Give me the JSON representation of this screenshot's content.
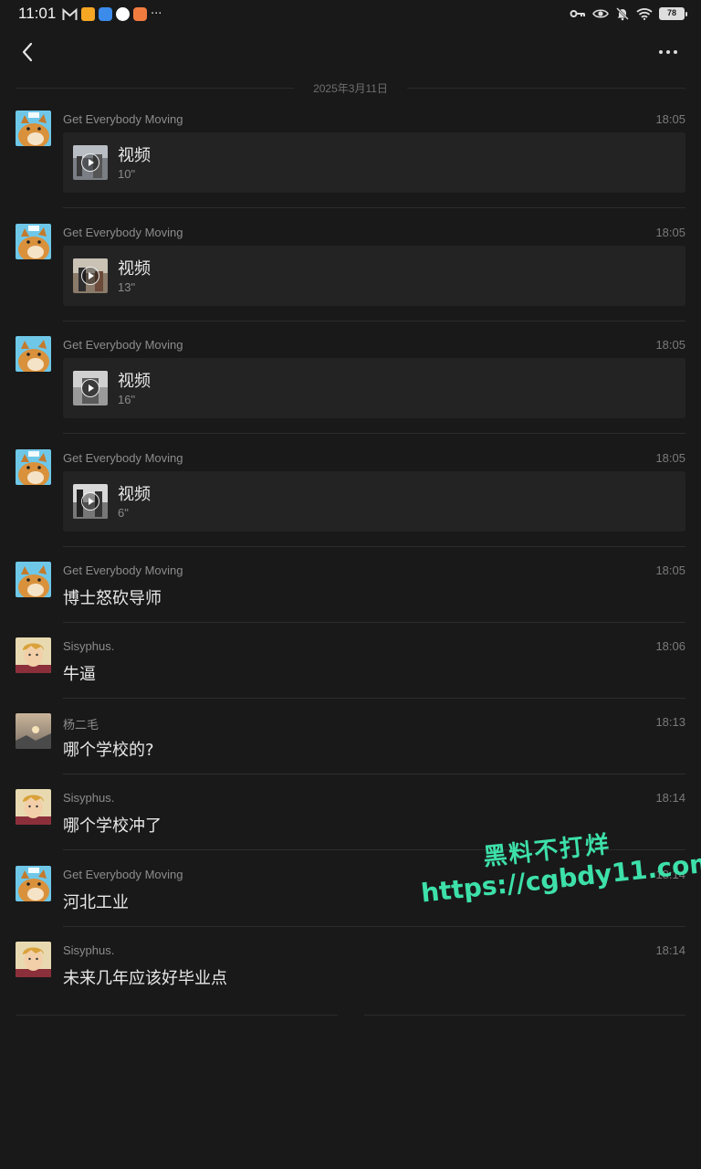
{
  "status_bar": {
    "time": "11:01",
    "more": "···",
    "battery": "78"
  },
  "date_divider": "2025年3月11日",
  "messages": [
    {
      "sender": "Get Everybody Moving",
      "time": "18:05",
      "type": "video",
      "label": "视频",
      "duration": "10\""
    },
    {
      "sender": "Get Everybody Moving",
      "time": "18:05",
      "type": "video",
      "label": "视频",
      "duration": "13\""
    },
    {
      "sender": "Get Everybody Moving",
      "time": "18:05",
      "type": "video",
      "label": "视频",
      "duration": "16\""
    },
    {
      "sender": "Get Everybody Moving",
      "time": "18:05",
      "type": "video",
      "label": "视频",
      "duration": "6\""
    },
    {
      "sender": "Get Everybody Moving",
      "time": "18:05",
      "type": "text",
      "text": "博士怒砍导师"
    },
    {
      "sender": "Sisyphus.",
      "time": "18:06",
      "type": "text",
      "text": "牛逼"
    },
    {
      "sender": "杨二毛",
      "time": "18:13",
      "type": "text",
      "text": "哪个学校的?"
    },
    {
      "sender": "Sisyphus.",
      "time": "18:14",
      "type": "text",
      "text": "哪个学校冲了"
    },
    {
      "sender": "Get Everybody Moving",
      "time": "18:14",
      "type": "text",
      "text": "河北工业"
    },
    {
      "sender": "Sisyphus.",
      "time": "18:14",
      "type": "text",
      "text": "未来几年应该好毕业点"
    }
  ],
  "watermark": {
    "line1": "黑料不打烊",
    "line2": "https://cgbdy11.com",
    "color": "#3de0a9"
  },
  "icons": {
    "back": "back-arrow-icon",
    "more": "more-dots-icon",
    "play": "play-icon"
  }
}
